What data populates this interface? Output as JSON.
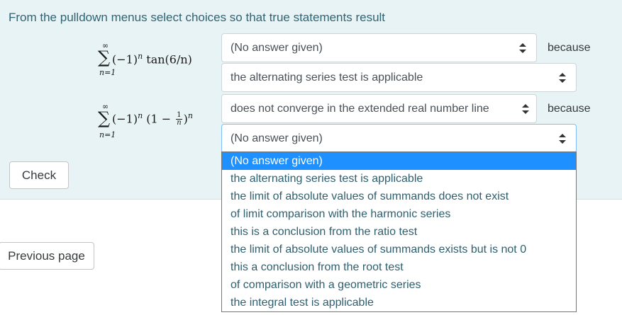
{
  "prompt": "From the pulldown menus select choices so that true statements result",
  "series": [
    {
      "sum_upper": "∞",
      "sum_lower": "n=1",
      "term_lead": "(−1)",
      "term_exp": "n",
      "term_rest": " tan(6/n)"
    },
    {
      "sum_upper": "∞",
      "sum_lower": "n=1",
      "term_lead": "(−1)",
      "term_exp": "n",
      "paren_open": "(1 − ",
      "frac_num": "1",
      "frac_den": "n",
      "paren_close": ")",
      "outer_exp": "n"
    }
  ],
  "rows": [
    {
      "verdict": "(No answer given)",
      "because": "because",
      "reason": "the alternating series test is applicable"
    },
    {
      "verdict": "does not converge in the extended real number line",
      "because": "because",
      "reason": "(No answer given)"
    }
  ],
  "buttons": {
    "check": "Check",
    "previous": "Previous page"
  },
  "dropdown_options": [
    "(No answer given)",
    "the alternating series test is applicable",
    "the limit of absolute values of summands does not exist",
    "of limit comparison with the harmonic series",
    "this is a conclusion from the ratio test",
    "the limit of absolute values of summands exists but is not 0",
    "this a conclusion from the root test",
    "of comparison with a geometric series",
    "the integral test is applicable"
  ],
  "dropdown_selected_index": 0,
  "colors": {
    "panel": "#e7f3f5",
    "prompt_text": "#2f6473",
    "highlight": "#1e90ff"
  }
}
